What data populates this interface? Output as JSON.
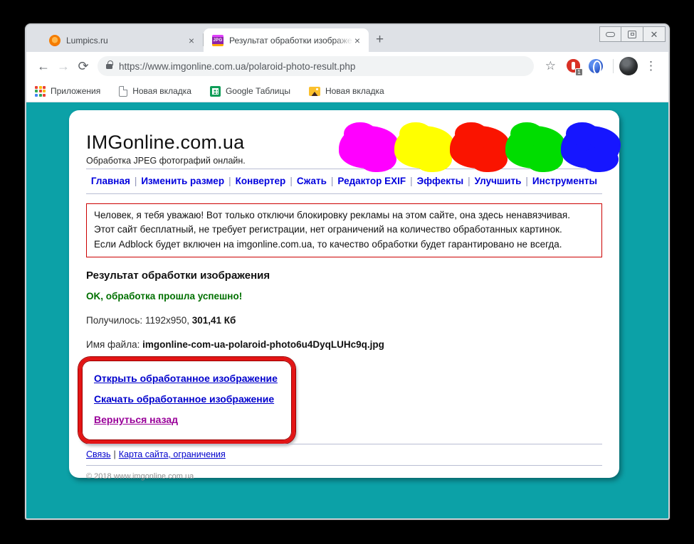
{
  "window": {
    "tabs": [
      {
        "title": "Lumpics.ru"
      },
      {
        "title": "Результат обработки изображе",
        "favicon_text": "JPG"
      }
    ],
    "glyphs": {
      "close_window": "✕",
      "tab_close": "×",
      "new_tab": "+",
      "back": "←",
      "forward": "→",
      "reload": "⟳",
      "star": "☆",
      "menu": "⋮"
    },
    "address": {
      "url": "https://www.imgonline.com.ua/polaroid-photo-result.php"
    },
    "extensions": {
      "red_badge": "1"
    },
    "bookmarks": [
      {
        "label": "Приложения"
      },
      {
        "label": "Новая вкладка"
      },
      {
        "label": "Google Таблицы"
      },
      {
        "label": "Новая вкладка"
      }
    ]
  },
  "site": {
    "title": "IMGonline.com.ua",
    "subtitle": "Обработка JPEG фотографий онлайн.",
    "nav": [
      "Главная",
      "Изменить размер",
      "Конвертер",
      "Сжать",
      "Редактор EXIF",
      "Эффекты",
      "Улучшить",
      "Инструменты"
    ],
    "nav_separator": "|",
    "blobs": [
      "--c:#ff00ff",
      "--c:#ffff00",
      "--c:#fa1400",
      "--c:#00dd00",
      "--c:#1616ff"
    ],
    "notice_lines": [
      "Человек, я тебя уважаю! Вот только отключи блокировку рекламы на этом сайте, она здесь ненавязчивая.",
      "Этот сайт бесплатный, не требует регистрации, нет ограничений на количество обработанных картинок.",
      "Если Adblock будет включен на imgonline.com.ua, то качество обработки будет гарантировано не всегда."
    ],
    "result": {
      "heading": "Результат обработки изображения",
      "status": "OK, обработка прошла успешно!",
      "size_label": "Получилось: 1192x950,",
      "size_value": "301,41 Кб",
      "file_label": "Имя файла:",
      "file_value": "imgonline-com-ua-polaroid-photo6u4DyqLUHc9q.jpg"
    },
    "links": {
      "open": "Открыть обработанное изображение",
      "download": "Скачать обработанное изображение",
      "back": "Вернуться назад"
    },
    "footer": {
      "link1": "Связь",
      "separator": "|",
      "link2": "Карта сайта, ограничения",
      "copyright": "© 2018 www.imgonline.com.ua"
    },
    "colors": {
      "page_background": "#0ca1a7",
      "link_blue": "#0000cd",
      "link_visited": "#990099",
      "status_green": "#007000",
      "notice_border": "#cc0000",
      "callout_red": "#e31515"
    }
  }
}
